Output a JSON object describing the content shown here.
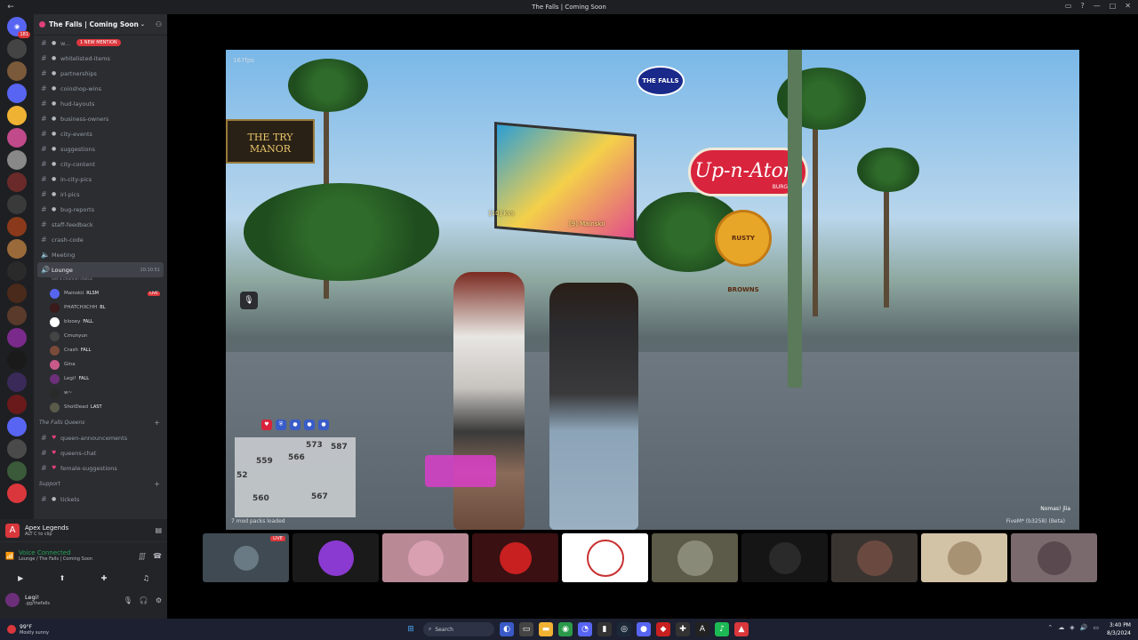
{
  "titlebar": {
    "title": "The Falls | Coming Soon"
  },
  "server": {
    "name": "The Falls | Coming Soon",
    "new_mention": "1 NEW MENTION",
    "channels": [
      {
        "label": "w..."
      },
      {
        "label": "whitelisted-items"
      },
      {
        "label": "partnerships"
      },
      {
        "label": "coinshop-wins"
      },
      {
        "label": "hud-layouts"
      },
      {
        "label": "business-owners"
      },
      {
        "label": "city-events"
      },
      {
        "label": "suggestions"
      },
      {
        "label": "city-content"
      },
      {
        "label": "in-city-pics"
      },
      {
        "label": "irl-pics"
      },
      {
        "label": "bug-reports"
      },
      {
        "label": "staff-feedback"
      },
      {
        "label": "crash-code"
      },
      {
        "label": "Meeting"
      }
    ],
    "voice_channel": {
      "label": "Lounge",
      "time": "10:10:51",
      "status": "Set a channel status"
    },
    "voice_users": [
      {
        "name": "Mainskii",
        "tag": "RLSM",
        "live": "LIVE"
      },
      {
        "name": "PHATCHXCHH",
        "tag": "BL"
      },
      {
        "name": "blooey",
        "tag": "FALL"
      },
      {
        "name": "Cmunyun",
        "tag": ""
      },
      {
        "name": "Crash",
        "tag": "FALL"
      },
      {
        "name": "Gina",
        "tag": ""
      },
      {
        "name": "Legi!",
        "tag": "FALL"
      },
      {
        "name": "w~",
        "tag": ""
      },
      {
        "name": "ShotDead",
        "tag": "LAST"
      }
    ],
    "category_queens": "The Falls Queens",
    "queens_channels": [
      {
        "label": "queen-announcements"
      },
      {
        "label": "queens-chat"
      },
      {
        "label": "female-suggestions"
      }
    ],
    "category_support": "Support",
    "support_channels": [
      {
        "label": "tickets"
      }
    ]
  },
  "activity": {
    "game": "Apex Legends",
    "hint_key": "ALT",
    "hint_key2": "C",
    "hint": "to clip"
  },
  "voice": {
    "status": "Voice Connected",
    "location": "Lounge / The Falls | Coming Soon"
  },
  "user": {
    "name": "Legi!",
    "sub": ".gg/thefalls"
  },
  "video": {
    "fps": "167fps",
    "tag1": "[10] kvs",
    "tag2": "[9] Mainskii",
    "sign_text": "Up-n-Atom",
    "sign_sub": "BURGER",
    "bakery_text": "RUSTY BROWNS",
    "manor_text": "THE TRY MANOR",
    "logo_text": "THE FALLS",
    "street_nums": [
      "559",
      "566",
      "573",
      "587",
      "52",
      "560",
      "567"
    ],
    "mods": "7 mod packs loaded",
    "build": "FiveM* (b3258) (Beta)",
    "corner": "Nomas! jlia"
  },
  "tiles": [
    {
      "name": "tile-1",
      "live": "LIVE",
      "color": "#3f4a52"
    },
    {
      "name": "tile-2",
      "color": "#1a1a1a"
    },
    {
      "name": "tile-3",
      "color": "#b98a96"
    },
    {
      "name": "tile-4",
      "color": "#3a1012"
    },
    {
      "name": "tile-5",
      "color": "#ffffff"
    },
    {
      "name": "tile-6",
      "color": "#5c5a48"
    },
    {
      "name": "tile-7",
      "color": "#151515"
    },
    {
      "name": "tile-8",
      "color": "#3a3430"
    },
    {
      "name": "tile-9",
      "color": "#d2c2a6"
    },
    {
      "name": "tile-10",
      "color": "#7a6a6e"
    }
  ],
  "taskbar": {
    "temp": "99°F",
    "weather": "Mostly sunny",
    "search": "Search",
    "time": "3:40 PM",
    "date": "8/3/2024"
  }
}
